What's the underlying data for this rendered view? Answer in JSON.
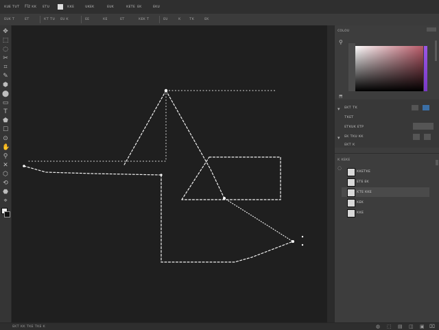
{
  "menubar": {
    "items": [
      "ᴋᴜᴇ ᴛᴜᴛ",
      "Flᴢ ᴋᴋ",
      "ᴇᴛᴜ",
      "ᴋᴋᴇ",
      "ᴜᴋᴇᴋ",
      "ᴇᴜᴋ",
      "ᴋᴇᴛᴇ",
      "ᴇᴋ",
      "ᴇᴋᴜ"
    ]
  },
  "options": {
    "items": [
      "ᴇᴜᴋ ᴛ",
      "ᴇᴛ",
      "ᴋᴛ ᴛᴜ",
      "ᴇᴜ ᴋ",
      "ᴇᴇ",
      "ᴋᴇ",
      "ᴇᴛ",
      "ᴋᴇᴋ ᴛ",
      "ᴇᴜ",
      "ᴋ",
      "ᴛᴋ",
      "ᴇᴋ"
    ]
  },
  "tools": [
    "✥",
    "⬚",
    "◌",
    "✂",
    "⌗",
    "✎",
    "⬢",
    "⬤",
    "▭",
    "T",
    "⬟",
    "☐",
    "⊙",
    "✋",
    "⚲",
    "✕",
    "⬡",
    "⟲",
    "⬣",
    "⌖"
  ],
  "panels": {
    "color_tab": "ᴄᴏʟᴏᴜ",
    "properties": {
      "rows": [
        "ᴇᴋᴛ ᴛᴋ",
        "ᴛᴋᴇᴛ",
        "ᴇᴛᴋᴜᴋ ᴇᴛᴘ",
        "ᴇᴋ ᴛᴋᴜ ᴋᴋ",
        "ᴇᴋᴛ ᴋ"
      ]
    },
    "layers_tab": "ᴋ ᴋᴇᴋᴇ",
    "layers": [
      {
        "label": "ᴋᴋᴇᴛᴋᴇ"
      },
      {
        "label": "ᴇᴛᴇ ᴇᴋ"
      },
      {
        "label": "ᴋᴛᴇ ᴋᴋᴇ"
      },
      {
        "label": "ᴋᴇᴋ"
      },
      {
        "label": "ᴋᴋᴇ"
      }
    ]
  },
  "status": {
    "left": "ᴇᴋᴛ ᴋᴋ ᴛᴋᴇ ᴛᴋᴇ ᴋ"
  },
  "colors": {
    "canvas": "#1f1f1f",
    "accent": "#9b57e6",
    "path": "#f2f2f2"
  }
}
